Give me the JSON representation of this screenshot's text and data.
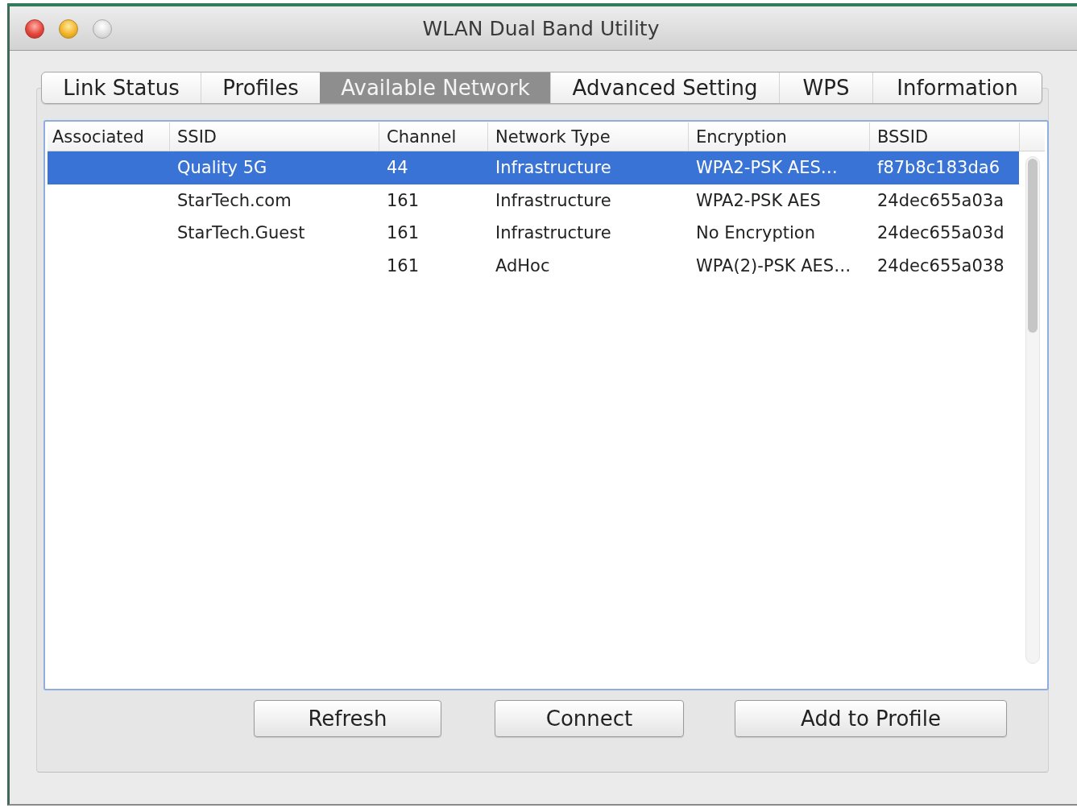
{
  "window": {
    "title": "WLAN Dual Band Utility",
    "controls": [
      {
        "kind": "close",
        "disabled": false
      },
      {
        "kind": "minimize",
        "disabled": false
      },
      {
        "kind": "zoom",
        "disabled": true
      }
    ]
  },
  "tabs": [
    {
      "label": "Link Status",
      "selected": false
    },
    {
      "label": "Profiles",
      "selected": false
    },
    {
      "label": "Available Network",
      "selected": true
    },
    {
      "label": "Advanced Setting",
      "selected": false
    },
    {
      "label": "WPS",
      "selected": false
    },
    {
      "label": "Information",
      "selected": false
    }
  ],
  "table": {
    "columns": [
      "Associated",
      "SSID",
      "Channel",
      "Network Type",
      "Encryption",
      "BSSID"
    ],
    "rows": [
      {
        "selected": true,
        "ssid": "Quality 5G",
        "channel": "44",
        "network_type": "Infrastructure",
        "encryption": "WPA2-PSK AES…",
        "bssid": "f87b8c183da6"
      },
      {
        "selected": false,
        "ssid": "StarTech.com",
        "channel": "161",
        "network_type": "Infrastructure",
        "encryption": "WPA2-PSK AES",
        "bssid": "24dec655a03a"
      },
      {
        "selected": false,
        "ssid": "StarTech.Guest",
        "channel": "161",
        "network_type": "Infrastructure",
        "encryption": "No Encryption",
        "bssid": "24dec655a03d"
      },
      {
        "selected": false,
        "channel": "161",
        "network_type": "AdHoc",
        "encryption": "WPA(2)-PSK AES…",
        "bssid": "24dec655a038"
      }
    ]
  },
  "buttons": [
    "Refresh",
    "Connect",
    "Add to Profile"
  ]
}
